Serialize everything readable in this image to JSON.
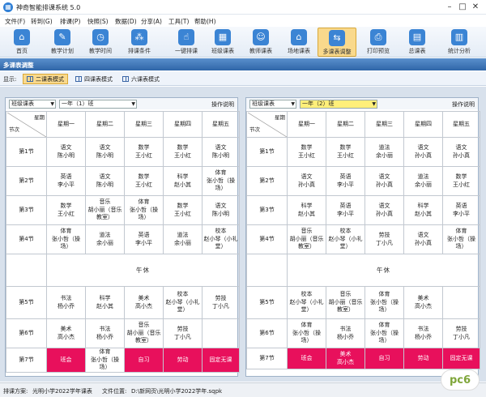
{
  "window": {
    "icon": "calendar-icon",
    "title": "神奇智能排课系统 5.0",
    "min": "–",
    "max": "□",
    "close": "✕"
  },
  "menu": [
    "文件(F)",
    "转到(G)",
    "排课(P)",
    "快照(S)",
    "数据(D)",
    "分享(A)",
    "工具(T)",
    "帮助(H)"
  ],
  "toolbar": [
    {
      "label": "首页",
      "icon": "home-icon",
      "glyph": "⌂"
    },
    {
      "label": "教学计划",
      "icon": "clipboard-icon",
      "glyph": "✎"
    },
    {
      "label": "教学时间",
      "icon": "clock-icon",
      "glyph": "◷"
    },
    {
      "label": "排课条件",
      "icon": "conditions-icon",
      "glyph": "⁂"
    },
    {
      "label": "一键排课",
      "icon": "hand-click-icon",
      "glyph": "☝"
    },
    {
      "label": "班级课表",
      "icon": "grid-icon",
      "glyph": "▦"
    },
    {
      "label": "教师课表",
      "icon": "teacher-icon",
      "glyph": "☺"
    },
    {
      "label": "场地课表",
      "icon": "building-icon",
      "glyph": "⌂"
    },
    {
      "label": "多课表调整",
      "icon": "adjust-icon",
      "glyph": "⇆"
    },
    {
      "label": "打印预览",
      "icon": "printer-icon",
      "glyph": "⎙"
    },
    {
      "label": "总课表",
      "icon": "table-icon",
      "glyph": "▤"
    },
    {
      "label": "统计分析",
      "icon": "bar-chart-icon",
      "glyph": "▥"
    }
  ],
  "active_tool": "多课表调整",
  "section_title": "多课表调整",
  "mode_label": "显示:",
  "modes": [
    "二课表模式",
    "四课表模式",
    "六课表模式"
  ],
  "active_mode": "二课表模式",
  "days": [
    "星期一",
    "星期二",
    "星期三",
    "星期四",
    "星期五"
  ],
  "corner": {
    "top": "星期",
    "bottom": "节次"
  },
  "periods": [
    "第1节",
    "第2节",
    "第3节",
    "第4节",
    "第5节",
    "第6节",
    "第7节"
  ],
  "lunch": "午休",
  "help": "操作说明",
  "panels": [
    {
      "type": "班级课表",
      "class": "一年（1）班",
      "rows": [
        [
          "语文\n陈小明",
          "语文\n陈小明",
          "数学\n王小红",
          "数学\n王小红",
          "语文\n陈小明"
        ],
        [
          "英语\n李小平",
          "语文\n陈小明",
          "数学\n王小红",
          "科学\n赵小其",
          "体育\n张小哲（操场）"
        ],
        [
          "数学\n王小红",
          "音乐\n胡小丽（音乐教室）",
          "体育\n张小哲（操场）",
          "数学\n王小红",
          "语文\n陈小明"
        ],
        [
          "体育\n张小哲（操场）",
          "道法\n余小丽",
          "英语\n李小平",
          "道法\n余小丽",
          "校本\n赵小琴（小礼堂）"
        ],
        [
          "书法\n杨小乔",
          "科学\n赵小其",
          "美术\n高小杰",
          "校本\n赵小琴（小礼堂）",
          "劳技\n丁小凡"
        ],
        [
          "美术\n高小杰",
          "书法\n杨小乔",
          "音乐\n胡小丽（音乐教室）",
          "劳技\n丁小凡",
          ""
        ],
        [
          "班会",
          "体育\n张小哲（操场）",
          "自习",
          "劳动",
          "固定无课"
        ]
      ],
      "pink": [
        [
          6,
          0
        ],
        [
          6,
          2
        ],
        [
          6,
          3
        ],
        [
          6,
          4
        ]
      ]
    },
    {
      "type": "班级课表",
      "class": "一年（2）班",
      "rows": [
        [
          "数学\n王小红",
          "数学\n王小红",
          "道法\n余小丽",
          "语文\n孙小真",
          "语文\n孙小真"
        ],
        [
          "语文\n孙小真",
          "英语\n李小平",
          "语文\n孙小真",
          "道法\n余小丽",
          "数学\n王小红"
        ],
        [
          "科学\n赵小其",
          "英语\n李小平",
          "语文\n孙小真",
          "科学\n赵小其",
          "英语\n李小平"
        ],
        [
          "音乐\n胡小丽（音乐教室）",
          "校本\n赵小琴（小礼堂）",
          "劳技\n丁小凡",
          "语文\n孙小真",
          "体育\n张小哲（操场）"
        ],
        [
          "校本\n赵小琴（小礼堂）",
          "音乐\n胡小丽（音乐教室）",
          "体育\n张小哲（操场）",
          "美术\n高小杰",
          ""
        ],
        [
          "体育\n张小哲（操场）",
          "书法\n杨小乔",
          "体育\n张小哲（操场）",
          "书法\n杨小乔",
          "劳技\n丁小凡"
        ],
        [
          "班会",
          "美术\n高小杰",
          "自习",
          "劳动",
          "固定无课"
        ]
      ],
      "pink": [
        [
          6,
          0
        ],
        [
          6,
          1
        ],
        [
          6,
          2
        ],
        [
          6,
          3
        ],
        [
          6,
          4
        ]
      ]
    }
  ],
  "status": {
    "plan_label": "排课方案:",
    "plan": "光明小学2022学年课表",
    "file_label": "文件位置:",
    "file": "D:\\新网页\\光明小学2022学年.sqpk"
  },
  "watermark": "pc6"
}
